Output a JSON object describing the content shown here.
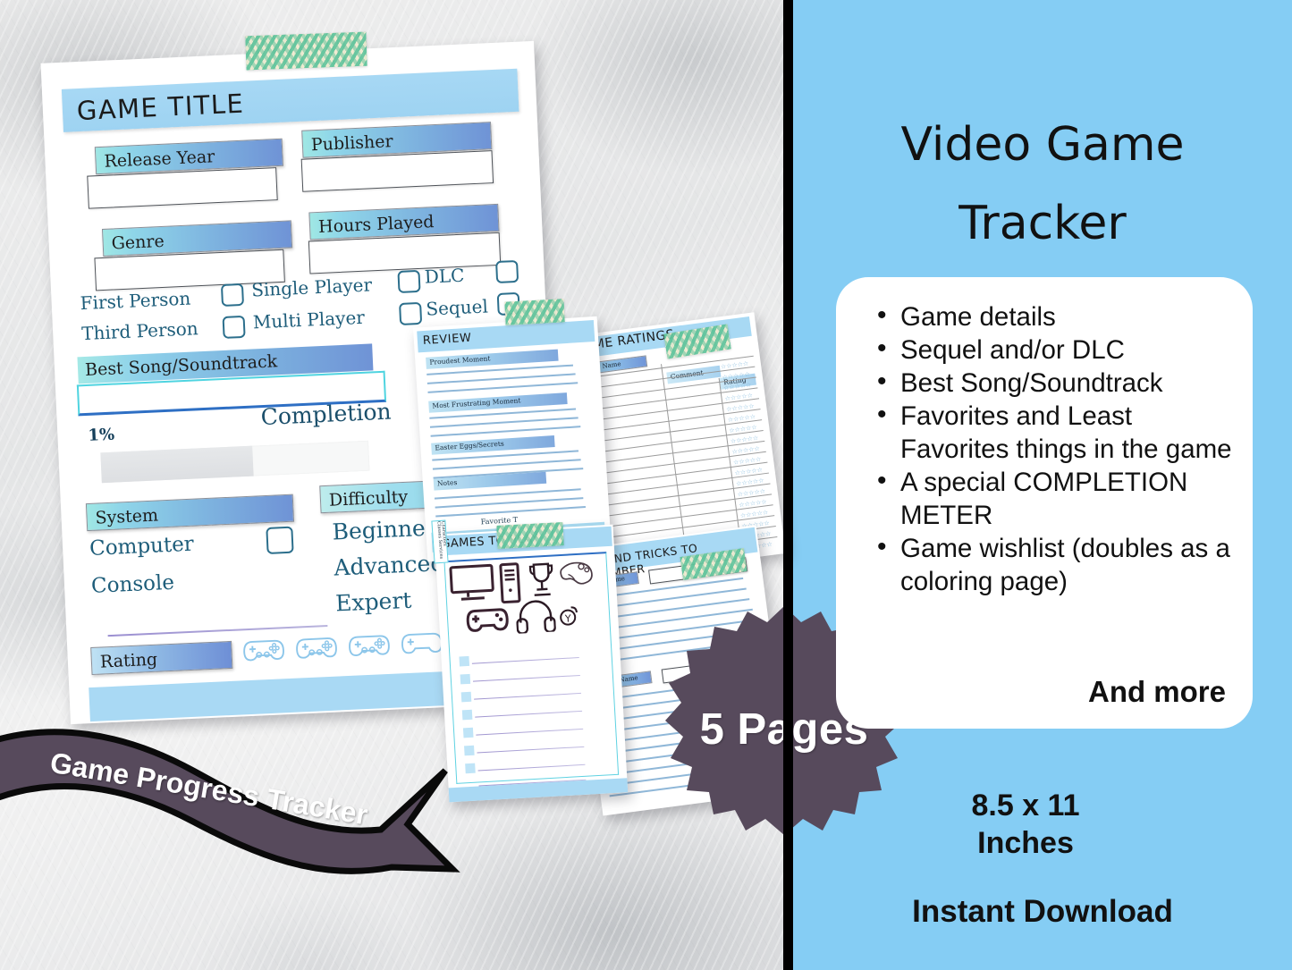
{
  "colors": {
    "panel_blue": "#85cdf4",
    "accent_purple": "#574a5c",
    "band_blue": "#a9d9f4",
    "label_gradient_start": "#9fe7e4",
    "label_gradient_end": "#6f93d6",
    "divider_black": "#000000",
    "washi_green": "#5fc39a",
    "washi_cream": "#f2ead0"
  },
  "right_panel": {
    "title_line1": "Video Game",
    "title_line2": "Tracker",
    "features": [
      "Game details",
      "Sequel and/or DLC",
      "Best Song/Soundtrack",
      "Favorites and Least Favorites things in the game",
      "A special COMPLETION METER",
      "Game wishlist (doubles as a coloring page)"
    ],
    "and_more": "And more",
    "size_line1": "8.5 x 11",
    "size_line2": "Inches",
    "instant_download": "Instant Download"
  },
  "ribbon": {
    "label": "Game Progress Tracker"
  },
  "badge": {
    "label": "5 Pages"
  },
  "main_page": {
    "header": "GAME TITLE",
    "fields": [
      {
        "label": "Release Year",
        "value": ""
      },
      {
        "label": "Publisher",
        "value": ""
      },
      {
        "label": "Genre",
        "value": ""
      },
      {
        "label": "Hours Played",
        "value": ""
      }
    ],
    "perspective_options": [
      "First Person",
      "Third Person"
    ],
    "player_options": [
      "Single Player",
      "Multi Player"
    ],
    "content_options": [
      "DLC",
      "Sequel"
    ],
    "soundtrack_label": "Best Song/Soundtrack",
    "soundtrack_value": "",
    "completion_label": "Completion",
    "completion_percent": "1%",
    "completion_value": 1,
    "system_label": "System",
    "system_options": [
      "Computer",
      "Console"
    ],
    "difficulty_label": "Difficulty",
    "difficulty_options": [
      "Beginner",
      "Advanced",
      "Expert"
    ],
    "rating_label": "Rating",
    "rating_icons": [
      "gamepad-icon",
      "gamepad-icon",
      "gamepad-icon",
      "gamepad-icon"
    ]
  },
  "review_page": {
    "header": "REVIEW",
    "sections": [
      "Proudest Moment",
      "Most Frustrating Moment",
      "Easter Eggs/Secrets",
      "Notes"
    ],
    "footer_label": "Favorite  T"
  },
  "ratings_page": {
    "header": "GAME RATINGS",
    "columns": [
      "Game Name",
      "Comment",
      "Rating"
    ],
    "star_row": "☆☆☆☆☆",
    "row_count": 18
  },
  "games_to_play_page": {
    "header": "GAMES TO PLAY",
    "icons": [
      "monitor-icon",
      "pc-tower-icon",
      "trophy-icon",
      "controller-icon",
      "gamepad-icon",
      "headphones-icon"
    ],
    "line_count": 8
  },
  "tips_page": {
    "header": "TIPS AND TRICKS TO REMEMBER",
    "game_name_label": "Game Name",
    "entries": 2
  },
  "side_tab": {
    "label": "Characters Classes Services"
  }
}
